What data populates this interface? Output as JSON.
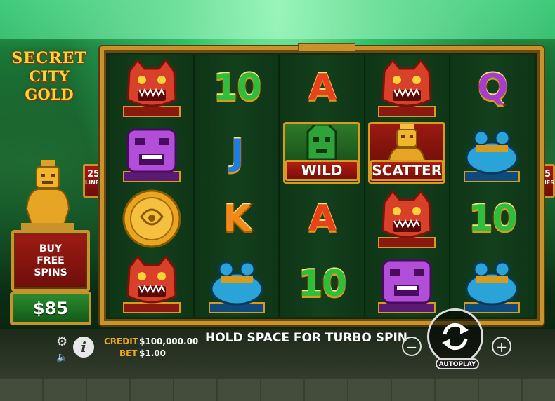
{
  "game": {
    "logo_line1": "SECRET",
    "logo_line2": "CITY GOLD"
  },
  "buy_feature": {
    "label_line1": "BUY",
    "label_line2": "FREE",
    "label_line3": "SPINS",
    "price": "$85"
  },
  "paylines": {
    "count": "25",
    "label": "LINES"
  },
  "reels": [
    [
      "jaguar-mask",
      "purple-mask",
      "gold-coin",
      "jaguar-mask"
    ],
    [
      "10",
      "J",
      "K",
      "frog"
    ],
    [
      "A",
      "wild",
      "A",
      "10"
    ],
    [
      "jaguar-mask",
      "scatter",
      "jaguar-mask",
      "purple-mask"
    ],
    [
      "Q",
      "frog",
      "10",
      "frog"
    ]
  ],
  "symbols": {
    "wild_label": "WILD",
    "scatter_label": "SCATTER",
    "card_10": "10",
    "card_J": "J",
    "card_K": "K",
    "card_A": "A",
    "card_Q": "Q"
  },
  "status": {
    "credit_label": "CREDIT",
    "credit_value": "$100,000.00",
    "bet_label": "BET",
    "bet_value": "$1.00",
    "message": "HOLD SPACE FOR TURBO SPIN"
  },
  "controls": {
    "minus": "−",
    "plus": "+",
    "autoplay_label": "AUTOPLAY",
    "info": "i"
  },
  "colors": {
    "gold": "#c9932b",
    "red": "#a8190f",
    "green": "#2a8a2f",
    "orange_text": "#f2a81a"
  }
}
